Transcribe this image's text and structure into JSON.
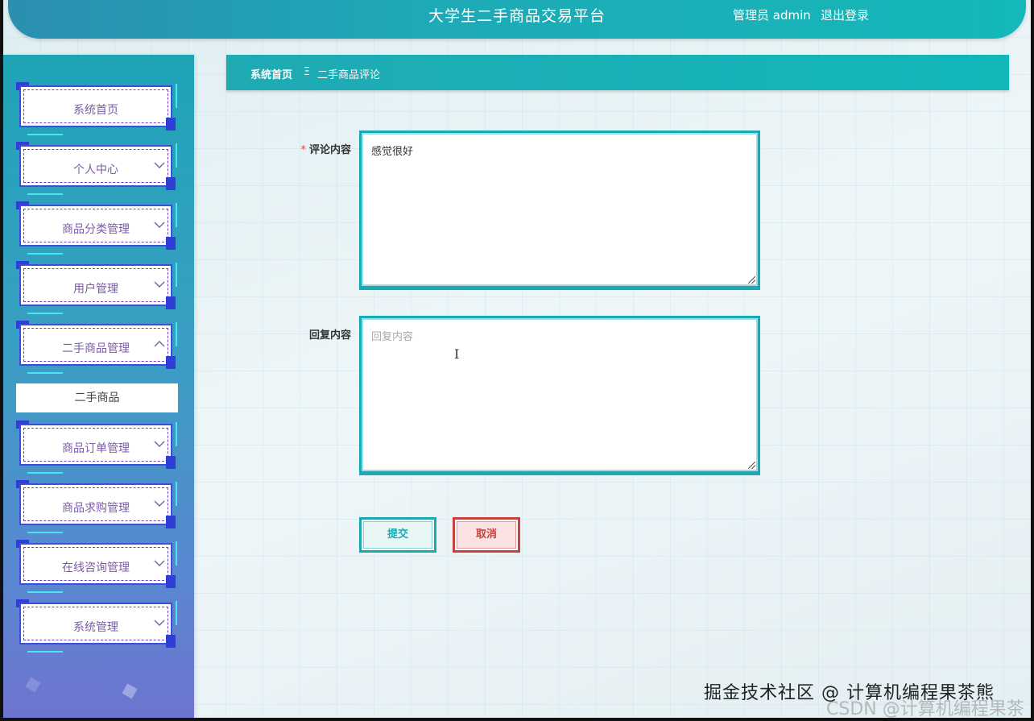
{
  "header": {
    "title": "大学生二手商品交易平台",
    "user": "管理员 admin",
    "logout": "退出登录"
  },
  "breadcrumb": {
    "home": "系统首页",
    "separator": "Ξ",
    "current": "二手商品评论"
  },
  "sidebar": {
    "items": [
      {
        "label": "系统首页",
        "chevron": ""
      },
      {
        "label": "个人中心",
        "chevron": "down"
      },
      {
        "label": "商品分类管理",
        "chevron": "down"
      },
      {
        "label": "用户管理",
        "chevron": "down"
      },
      {
        "label": "二手商品管理",
        "chevron": "up"
      },
      {
        "label": "商品订单管理",
        "chevron": "down"
      },
      {
        "label": "商品求购管理",
        "chevron": "down"
      },
      {
        "label": "在线咨询管理",
        "chevron": "down"
      },
      {
        "label": "系统管理",
        "chevron": "down"
      }
    ],
    "sub_item": "二手商品"
  },
  "form": {
    "comment_label": "评论内容",
    "comment_required_mark": "*",
    "comment_value": "感觉很好",
    "reply_label": "回复内容",
    "reply_placeholder": "回复内容",
    "submit": "提交",
    "cancel": "取消"
  },
  "watermark": {
    "line1": "掘金技术社区 @ 计算机编程果茶熊",
    "line2": "CSDN @计算机编程果茶熊"
  },
  "colors": {
    "accent": "#1baab5",
    "cancel": "#c9403f",
    "menu_border": "#3c4fd8"
  }
}
